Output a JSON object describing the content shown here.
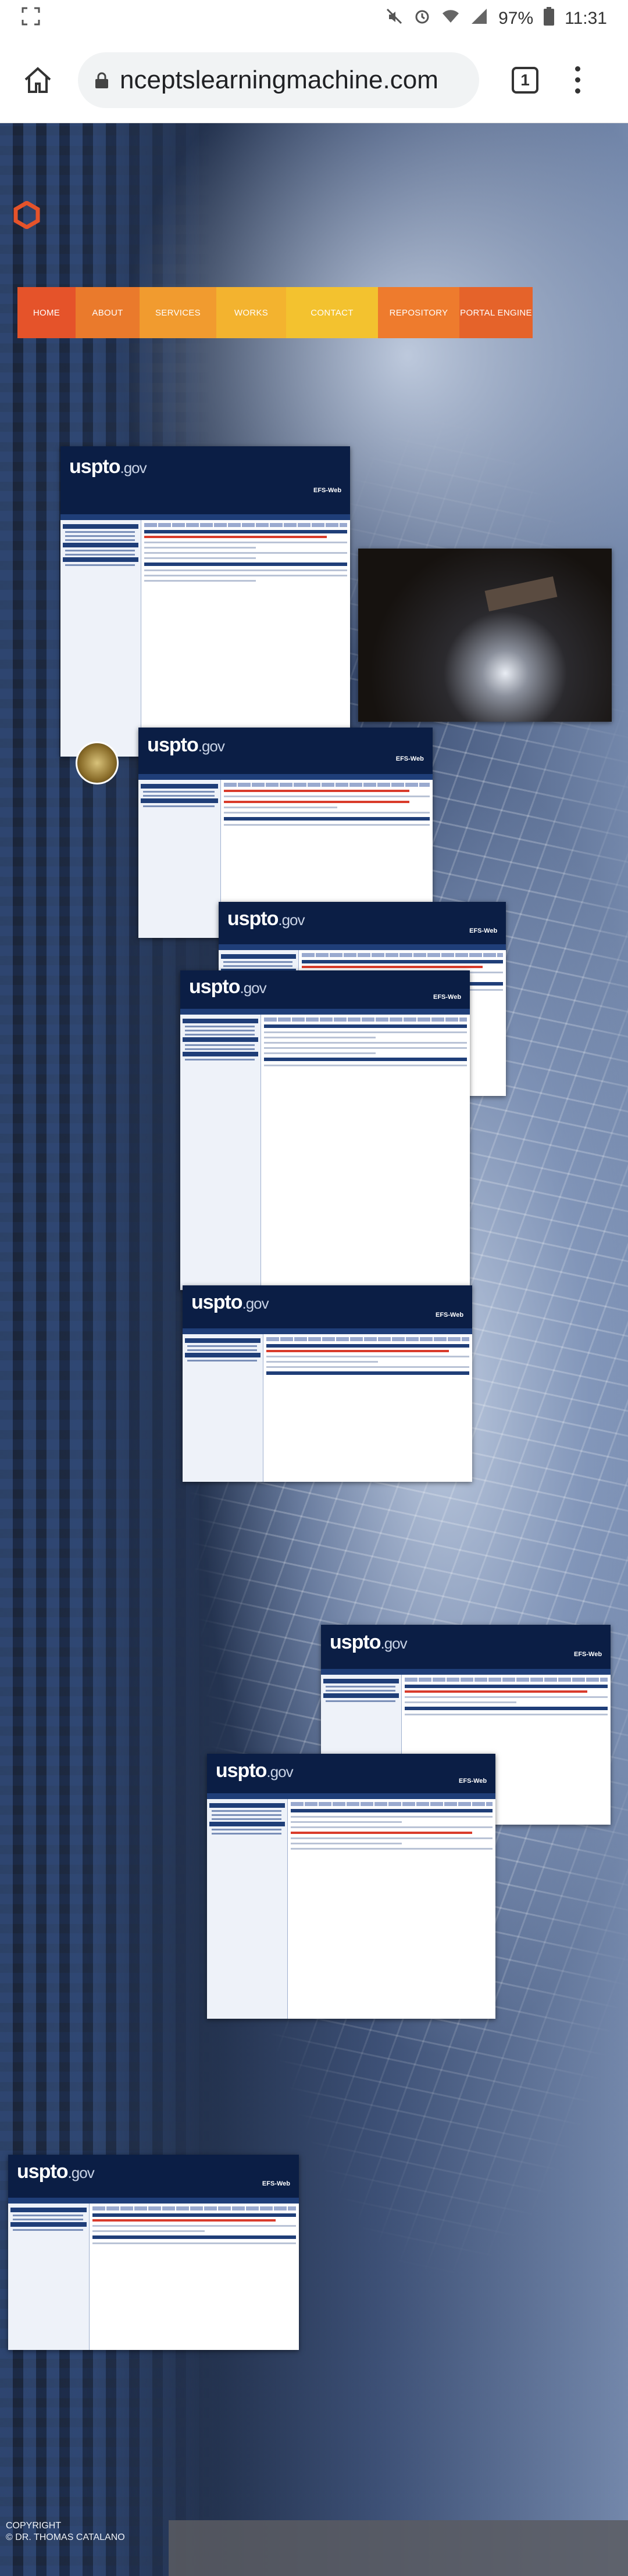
{
  "status_bar": {
    "time": "11:31",
    "battery": "97%",
    "icons": [
      "screenshot-icon",
      "mute-icon",
      "alarm-icon",
      "wifi-icon",
      "signal-icon",
      "battery-icon"
    ]
  },
  "browser": {
    "url": "nceptslearningmachine.com",
    "tab_count": "1",
    "icons": [
      "home-icon",
      "lock-icon",
      "tabs-icon",
      "menu-icon"
    ]
  },
  "nav": {
    "items": [
      {
        "label": "HOME",
        "color": "#E5532A"
      },
      {
        "label": "ABOUT",
        "color": "#EA7A2C"
      },
      {
        "label": "SERVICES",
        "color": "#F19B2F"
      },
      {
        "label": "WORKS",
        "color": "#F3B32F"
      },
      {
        "label": "CONTACT",
        "color": "#F3C22F"
      },
      {
        "label": "REPOSITORY",
        "color": "#EE7B2D"
      },
      {
        "label": "PORTAL ENGINE",
        "color": "#E5632A"
      }
    ]
  },
  "screenshots": {
    "logo": "uspto",
    "logo_suffix": ".gov",
    "badge": "EFS-Web"
  },
  "footer": {
    "copyright_line1": "COPYRIGHT",
    "copyright_line2": "© DR. THOMAS CATALANO"
  },
  "colors": {
    "accent_orange": "#E5532A",
    "uspto_navy": "#0B1E45"
  }
}
